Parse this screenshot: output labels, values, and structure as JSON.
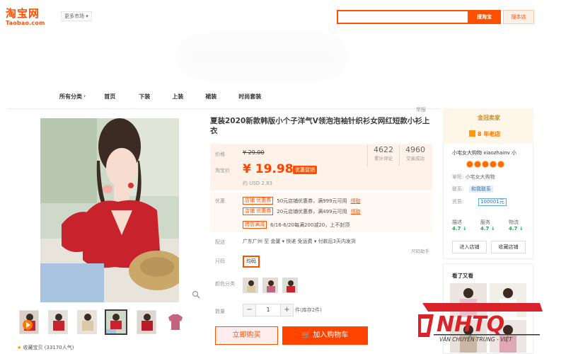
{
  "header": {
    "logo_cn": "淘宝网",
    "logo_en": "Taobao.com",
    "market_label": "更多市场",
    "search_button": "搜淘宝",
    "store_button": "搜本店"
  },
  "nav": {
    "items": [
      "所有分类",
      "首页",
      "下装",
      "上装",
      "裙装",
      "时尚套装"
    ]
  },
  "product": {
    "title": "夏装2020新款韩版小个子洋气V领泡泡袖针织衫女网红短款小衫上衣",
    "report": "举报",
    "price_label": "价格",
    "price_original": "¥ 29.00",
    "taobao_price_label": "淘宝价",
    "price_current": "¥ 19.98",
    "promo_badge": "优惠促销",
    "usd": "约 USD 2.83",
    "stats": [
      {
        "value": "4622",
        "label": "累计评论"
      },
      {
        "value": "4960",
        "label": "交易成功"
      }
    ],
    "coupons_label": "优惠",
    "coupons": [
      {
        "tag": "店铺 优惠券",
        "text": "50元店铺优惠券，满999元可用",
        "action": "领取"
      },
      {
        "tag": "店铺 优惠券",
        "text": "20元店铺优惠券，满499元可用",
        "action": "领取"
      },
      {
        "tag": "跨店满减",
        "text": "6/16-6/20每满200减20，上不封顶",
        "action": ""
      }
    ],
    "shipping_label": "配送",
    "shipping": "广东广州 至 金厦 ▾   快递 免运费 ▾   付款后3天内发货",
    "help": "尺码助手",
    "size_label": "尺码",
    "size_option": "均码",
    "color_label": "颜色分类",
    "qty_label": "数量",
    "qty_minus": "−",
    "qty_value": "1",
    "qty_plus": "+",
    "stock": "件(库存2件)",
    "buy_now": "立即购买",
    "add_cart": "加入购物车",
    "favorite": "收藏宝贝 (33170人气)"
  },
  "shop": {
    "badge": "金冠卖家",
    "years": "8 年老店",
    "name": "小宅女大购物 xiaozhainv 小",
    "seller_key": "掌柜:",
    "seller_val": "小宅女大购物",
    "contact_key": "联系:",
    "contact_val": "和我联系",
    "deposit_key": "资质:",
    "deposit_val": "100001元",
    "scores": [
      {
        "label": "描述",
        "value": "4.7 ↓"
      },
      {
        "label": "服务",
        "value": "4.7 ↓"
      },
      {
        "label": "物流",
        "value": "4.7 ↓"
      }
    ],
    "enter_button": "进入店铺",
    "favorite_button": "收藏店铺"
  },
  "seen": {
    "label": "看了又看"
  },
  "watermark": {
    "brand": "NHTQ",
    "tagline": "VẬN CHUYỂN TRUNG - VIỆT"
  },
  "colors": {
    "taobao_orange": "#ff5000",
    "price_red": "#ff4400",
    "watermark_red": "#d8232a"
  }
}
